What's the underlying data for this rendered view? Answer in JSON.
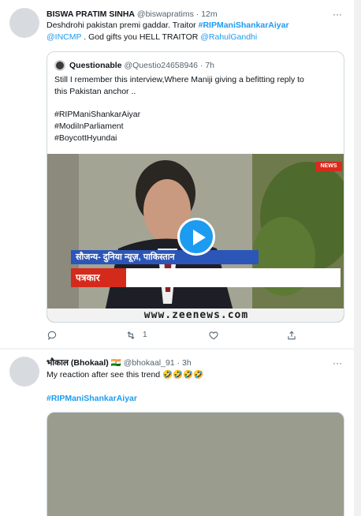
{
  "tweet1": {
    "name": "BISWA PRATIM SINHA",
    "handle": "@biswapratims",
    "sep": "·",
    "time": "12m",
    "more": "···",
    "text_a": "Deshdrohi pakistan premi gaddar. Traitor ",
    "hashtag": "#RIPManiShankarAiyar",
    "mention1": "@INCMP",
    "text_b": " . God gifts you HELL TRAITOR ",
    "mention2": "@RahulGandhi",
    "quote": {
      "name": "Questionable",
      "handle": "@Questio24658946",
      "sep": "·",
      "time": "7h",
      "line1": "Still I remember this interview,Where Maniji giving a befitting reply to",
      "line2": "this Pakistan anchor ..",
      "tag1": "#RIPManiShankarAiyar",
      "tag2": "#ModiInParliament",
      "tag3": "#BoycottHyundai",
      "video": {
        "band_text": "सौजन्य- दुनिया न्यूज़, पाकिस्तान",
        "band_label": "पत्रकार",
        "logo": "NEWS",
        "url": "www.zeenews.com"
      }
    },
    "actions": {
      "reply_count": "",
      "retweet_count": "1",
      "like_count": "",
      "share_count": ""
    }
  },
  "tweet2": {
    "name": "भौकाल (Bhokaal)",
    "flag": "🇮🇳",
    "handle": "@bhokaal_91",
    "sep": "·",
    "time": "3h",
    "more": "···",
    "text": "My reaction after see this trend 🤣🤣🤣🤣",
    "hashtag": "#RIPManiShankarAiyar"
  },
  "colors": {
    "link": "#1d9bf0",
    "muted": "#536471",
    "border": "#cfd9de"
  }
}
